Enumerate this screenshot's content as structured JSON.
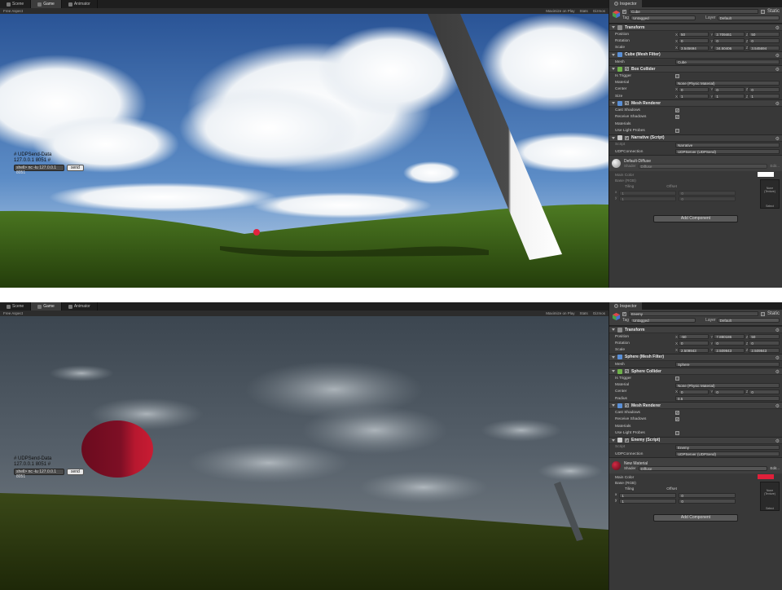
{
  "tabs": {
    "scene": "Scene",
    "game": "Game",
    "animator": "Animator",
    "inspector": "Inspector"
  },
  "toolbar": {
    "aspect": "Free Aspect",
    "maximize": "Maximize on Play",
    "stats": "Stats",
    "gizmos": "Gizmos"
  },
  "udp_overlay": {
    "title": "# UDPSend-Data",
    "address": "127.0.0.1 8051 #",
    "info": "shell> nc -lu 127.0.0.1 8051",
    "send_label": "send"
  },
  "top": {
    "object": {
      "name": "Cube",
      "static_label": "Static",
      "tag_label": "Tag",
      "tag": "Untagged",
      "layer_label": "Layer",
      "layer": "Default"
    },
    "transform": {
      "title": "Transform",
      "position": {
        "label": "Position",
        "x": "50",
        "y": "2.709461",
        "z": "50"
      },
      "rotation": {
        "label": "Rotation",
        "x": "0",
        "y": "0",
        "z": "0"
      },
      "scale": {
        "label": "Scale",
        "x": "3.545694",
        "y": "34.50406",
        "z": "3.545694"
      }
    },
    "mesh_filter": {
      "title": "Cube (Mesh Filter)",
      "mesh_label": "Mesh",
      "mesh": "Cube"
    },
    "collider": {
      "title": "Box Collider",
      "is_trigger_label": "Is Trigger",
      "material_label": "Material",
      "material": "None (Physic Material)",
      "center": {
        "label": "Center",
        "x": "0",
        "y": "0",
        "z": "0"
      },
      "size": {
        "label": "Size",
        "x": "1",
        "y": "1",
        "z": "1"
      }
    },
    "renderer": {
      "title": "Mesh Renderer",
      "cast_shadows": "Cast Shadows",
      "receive_shadows": "Receive Shadows",
      "materials": "Materials",
      "light_probes": "Use Light Probes"
    },
    "script": {
      "title": "Narrative (Script)",
      "script_label": "Script",
      "script": "Narrative",
      "udp_label": "UDPConnection",
      "udp": "UDPServer (UDPSend)"
    },
    "material": {
      "name": "Default-Diffuse",
      "shader_label": "Shader",
      "shader": "Diffuse",
      "edit": "Edit...",
      "main_color": "Main Color",
      "base_rgb": "Base (RGB)",
      "tiling": "Tiling",
      "offset": "Offset",
      "x": "x",
      "y": "y",
      "tx": "1",
      "ty": "1",
      "ox": "0",
      "oy": "0",
      "texture_none": "None (Texture)",
      "select": "Select",
      "color_hex": "#ffffff"
    },
    "add_component": "Add Component"
  },
  "bottom": {
    "object": {
      "name": "Enemy",
      "static_label": "Static",
      "tag_label": "Tag",
      "tag": "Untagged",
      "layer_label": "Layer",
      "layer": "Default"
    },
    "transform": {
      "title": "Transform",
      "position": {
        "label": "Position",
        "x": "-50",
        "y": "7.880186",
        "z": "50"
      },
      "rotation": {
        "label": "Rotation",
        "x": "0",
        "y": "0",
        "z": "0"
      },
      "scale": {
        "label": "Scale",
        "x": "2.509943",
        "y": "2.509943",
        "z": "2.509943"
      }
    },
    "mesh_filter": {
      "title": "Sphere (Mesh Filter)",
      "mesh_label": "Mesh",
      "mesh": "Sphere"
    },
    "collider": {
      "title": "Sphere Collider",
      "is_trigger_label": "Is Trigger",
      "material_label": "Material",
      "material": "None (Physic Material)",
      "center": {
        "label": "Center",
        "x": "0",
        "y": "0",
        "z": "0"
      },
      "radius_label": "Radius",
      "radius": "0.5"
    },
    "renderer": {
      "title": "Mesh Renderer",
      "cast_shadows": "Cast Shadows",
      "receive_shadows": "Receive Shadows",
      "materials": "Materials",
      "light_probes": "Use Light Probes"
    },
    "script": {
      "title": "Enemy (Script)",
      "script_label": "Script",
      "script": "Enemy",
      "udp_label": "UDPConnection",
      "udp": "UDPServer (UDPSend)"
    },
    "material": {
      "name": "New Material",
      "shader_label": "Shader",
      "shader": "Diffuse",
      "edit": "Edit...",
      "main_color": "Main Color",
      "base_rgb": "Base (RGB)",
      "tiling": "Tiling",
      "offset": "Offset",
      "x": "x",
      "y": "y",
      "tx": "1",
      "ty": "1",
      "ox": "0",
      "oy": "0",
      "texture_none": "None (Texture)",
      "select": "Select",
      "color_hex": "#e0203a"
    },
    "add_component": "Add Component"
  },
  "colors": {
    "sky_top": "#2f5fa8",
    "grass": "#3f6a1c",
    "enemy_sphere": "#9a0f2a",
    "inspector_bg": "#383838"
  }
}
